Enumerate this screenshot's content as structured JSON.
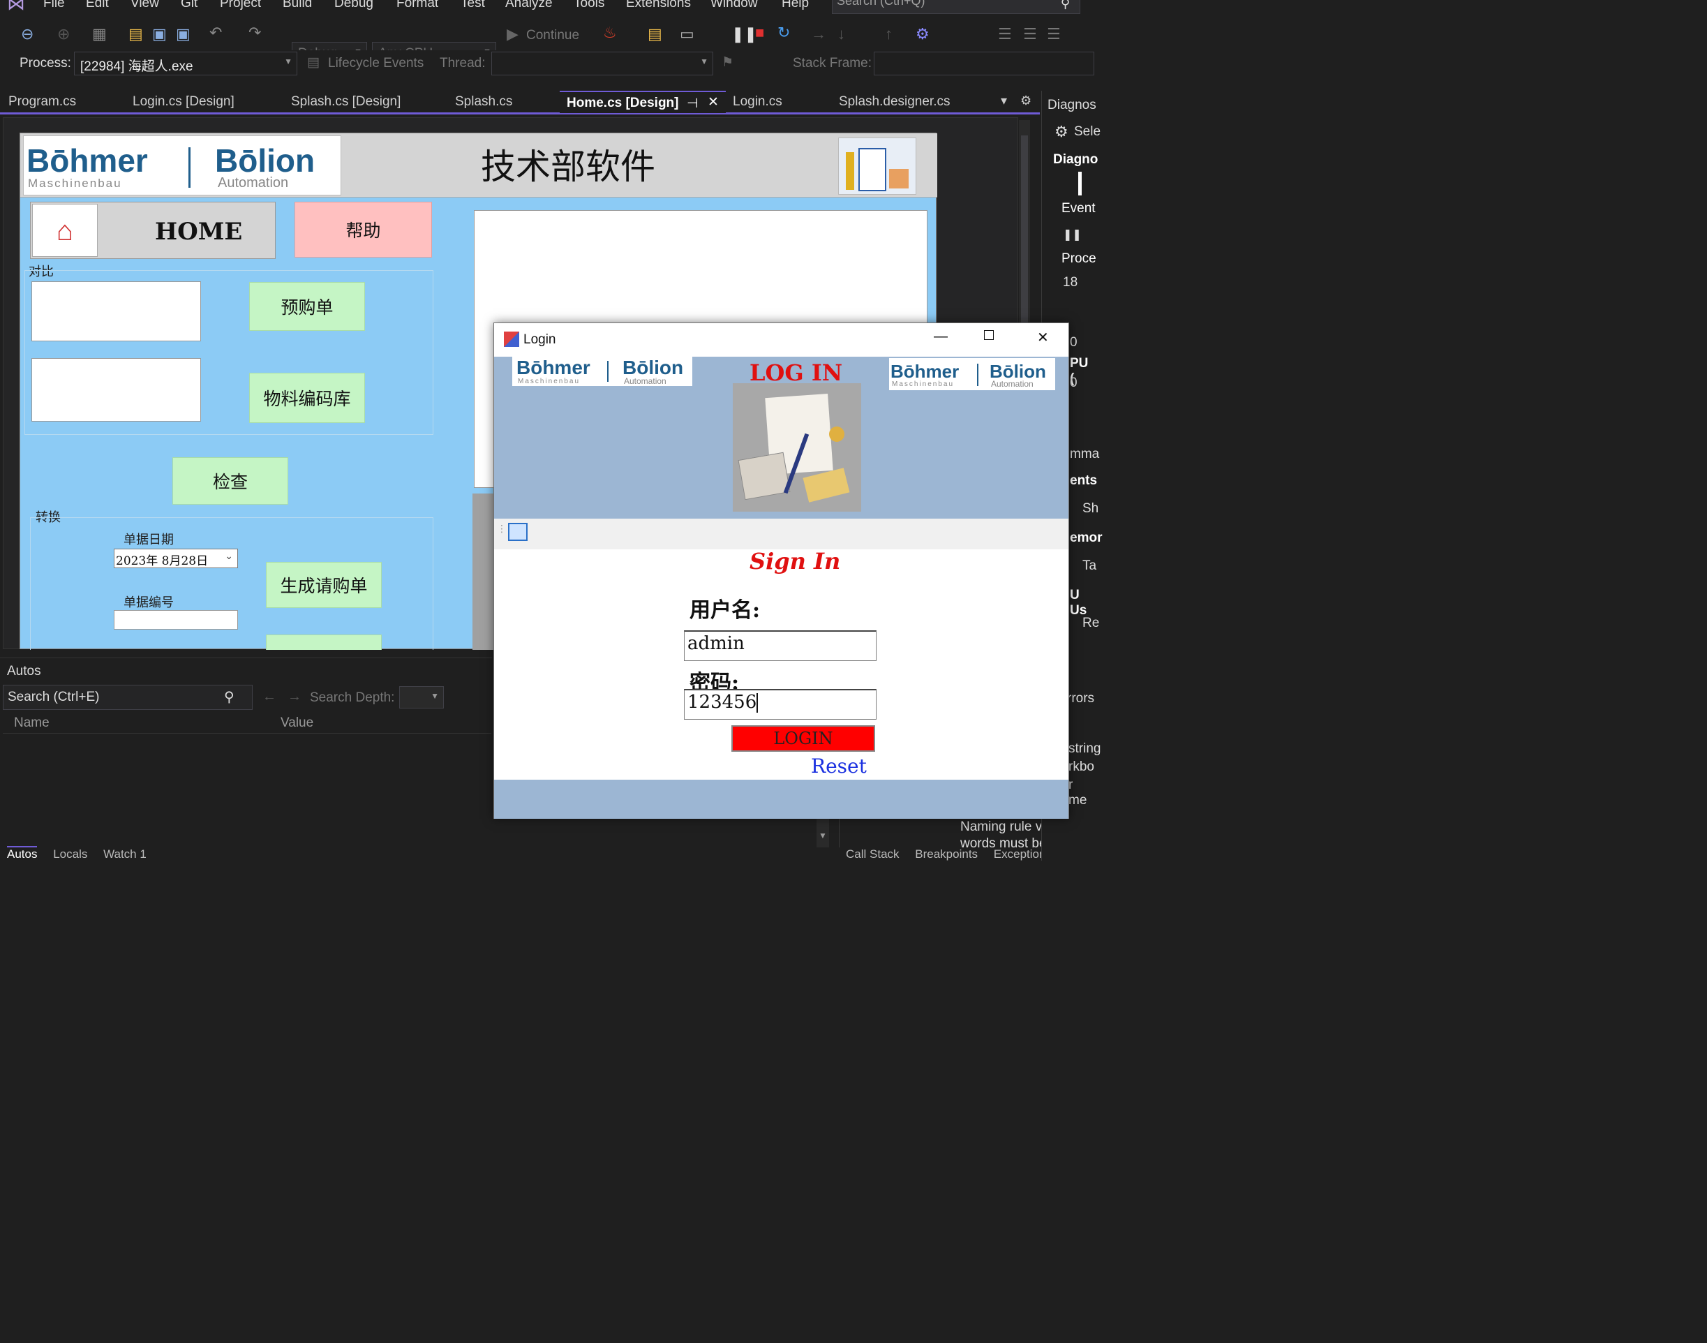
{
  "menu": {
    "items": [
      "File",
      "Edit",
      "View",
      "Git",
      "Project",
      "Build",
      "Debug",
      "Format",
      "Test",
      "Analyze",
      "Tools",
      "Extensions",
      "Window",
      "Help"
    ],
    "search_placeholder": "Search (Ctrl+Q)"
  },
  "toolbar": {
    "config": "Debug",
    "platform": "Any CPU",
    "continue_label": "Continue"
  },
  "process_bar": {
    "process_label": "Process:",
    "process_value": "[22984] 海超人.exe",
    "lifecycle_label": "Lifecycle Events",
    "thread_label": "Thread:",
    "stack_label": "Stack Frame:"
  },
  "tabs": [
    {
      "label": "Program.cs"
    },
    {
      "label": "Login.cs [Design]"
    },
    {
      "label": "Splash.cs [Design]"
    },
    {
      "label": "Splash.cs"
    },
    {
      "label": "Home.cs [Design]"
    },
    {
      "label": "Login.cs"
    },
    {
      "label": "Splash.designer.cs"
    }
  ],
  "home_form": {
    "logo1": "Bōhmer",
    "logo1_sub": "Maschinenbau",
    "logo2": "Bōlion",
    "logo2_sub": "Automation",
    "title": "技术部软件",
    "home_label": "HOME",
    "help_label": "帮助",
    "compare_group": "对比",
    "preorder_label": "预购单",
    "material_label": "物料编码库",
    "check_label": "检查",
    "convert_group": "转换",
    "doc_date_label": "单据日期",
    "doc_date_value": "2023年  8月28日",
    "generate_label": "生成请购单",
    "doc_no_label": "单据编号"
  },
  "autos": {
    "title": "Autos",
    "search_placeholder": "Search (Ctrl+E)",
    "depth_label": "Search Depth:",
    "col_name": "Name",
    "col_value": "Value",
    "bottom_tabs": [
      "Autos",
      "Locals",
      "Watch 1"
    ]
  },
  "right_panel": {
    "items": [
      "Diagnos",
      "Sele",
      "Diagno",
      "Event",
      "Proce",
      "18",
      "0",
      "PU (",
      "0",
      "mma",
      "ents",
      "Sh",
      "emor",
      "Ta",
      "U Us",
      "Re",
      "rrors",
      "string",
      "rkbo",
      "r me"
    ],
    "naming_text": "Naming rule violation:",
    "naming_text2": "words must begin with",
    "bottom_tabs": [
      "Call Stack",
      "Breakpoints",
      "Exception Settin"
    ]
  },
  "login_window": {
    "title": "Login",
    "heading": "LOG IN",
    "logo1": "Bōhmer",
    "logo1_sub": "Maschinenbau",
    "logo2": "Bōlion",
    "logo2_sub": "Automation",
    "sign_in": "Sign In",
    "username_label": "用户名:",
    "username_value": "admin",
    "password_label": "密码:",
    "password_value": "123456",
    "login_button": "LOGIN",
    "reset_link": "Reset"
  },
  "colors": {
    "accent": "#6f5bd6",
    "form_bg": "#8ccbf5",
    "button_green": "#c5f5c5",
    "help_pink": "#ffc0c0",
    "login_red": "#ff0000",
    "banner_blue": "#9cb6d3"
  }
}
